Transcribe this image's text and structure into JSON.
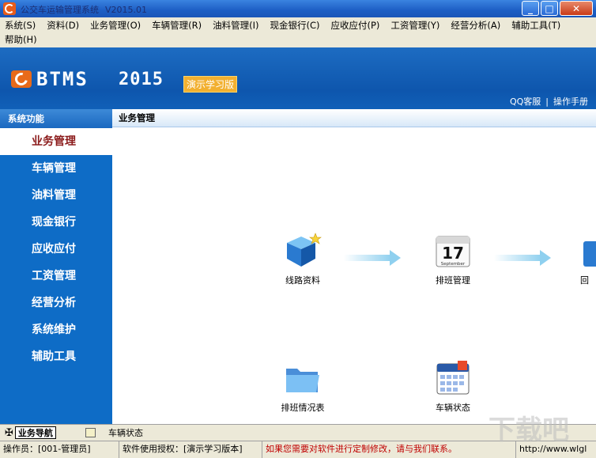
{
  "window": {
    "title": "公交车运输管理系统",
    "version": "V2015.01",
    "min": "_",
    "max": "□",
    "close": "✕"
  },
  "menu": {
    "row1": [
      "系统(S)",
      "资料(D)",
      "业务管理(O)",
      "车辆管理(R)",
      "油料管理(I)",
      "现金银行(C)",
      "应收应付(P)",
      "工资管理(Y)",
      "经营分析(A)",
      "辅助工具(T)"
    ],
    "row2": [
      "帮助(H)"
    ]
  },
  "banner": {
    "logo": "BTMS",
    "year": "2015",
    "edition": "演示学习版",
    "qq": "QQ客服",
    "sep": "|",
    "manual": "操作手册"
  },
  "sidebar": {
    "header": "系统功能",
    "items": [
      "业务管理",
      "车辆管理",
      "油料管理",
      "现金银行",
      "应收应付",
      "工资管理",
      "经营分析",
      "系统维护",
      "辅助工具"
    ],
    "active_index": 0
  },
  "main": {
    "title": "业务管理",
    "flow": [
      {
        "label": "线路资料",
        "icon": "cube-icon"
      },
      {
        "label": "排班管理",
        "icon": "calendar-icon",
        "day": "17",
        "month": "September"
      },
      {
        "label": "回",
        "icon": "partial-icon"
      },
      {
        "label": "排班情况表",
        "icon": "folder-icon"
      },
      {
        "label": "车辆状态",
        "icon": "calendar-grid-icon"
      }
    ]
  },
  "tabs": {
    "nav": "业务导航",
    "vehicle": "车辆状态"
  },
  "status": {
    "operator": "操作员：[001-管理员]",
    "license": "软件使用授权：[演示学习版本]",
    "notice": "如果您需要对软件进行定制修改，请与我们联系。",
    "url": "http://www.wlgl"
  },
  "watermark": "下载吧",
  "colors": {
    "sidebar": "#0e6cc6",
    "active_text": "#8b1a1a",
    "notice": "#c00000",
    "arrow": "#8fd0ef"
  }
}
